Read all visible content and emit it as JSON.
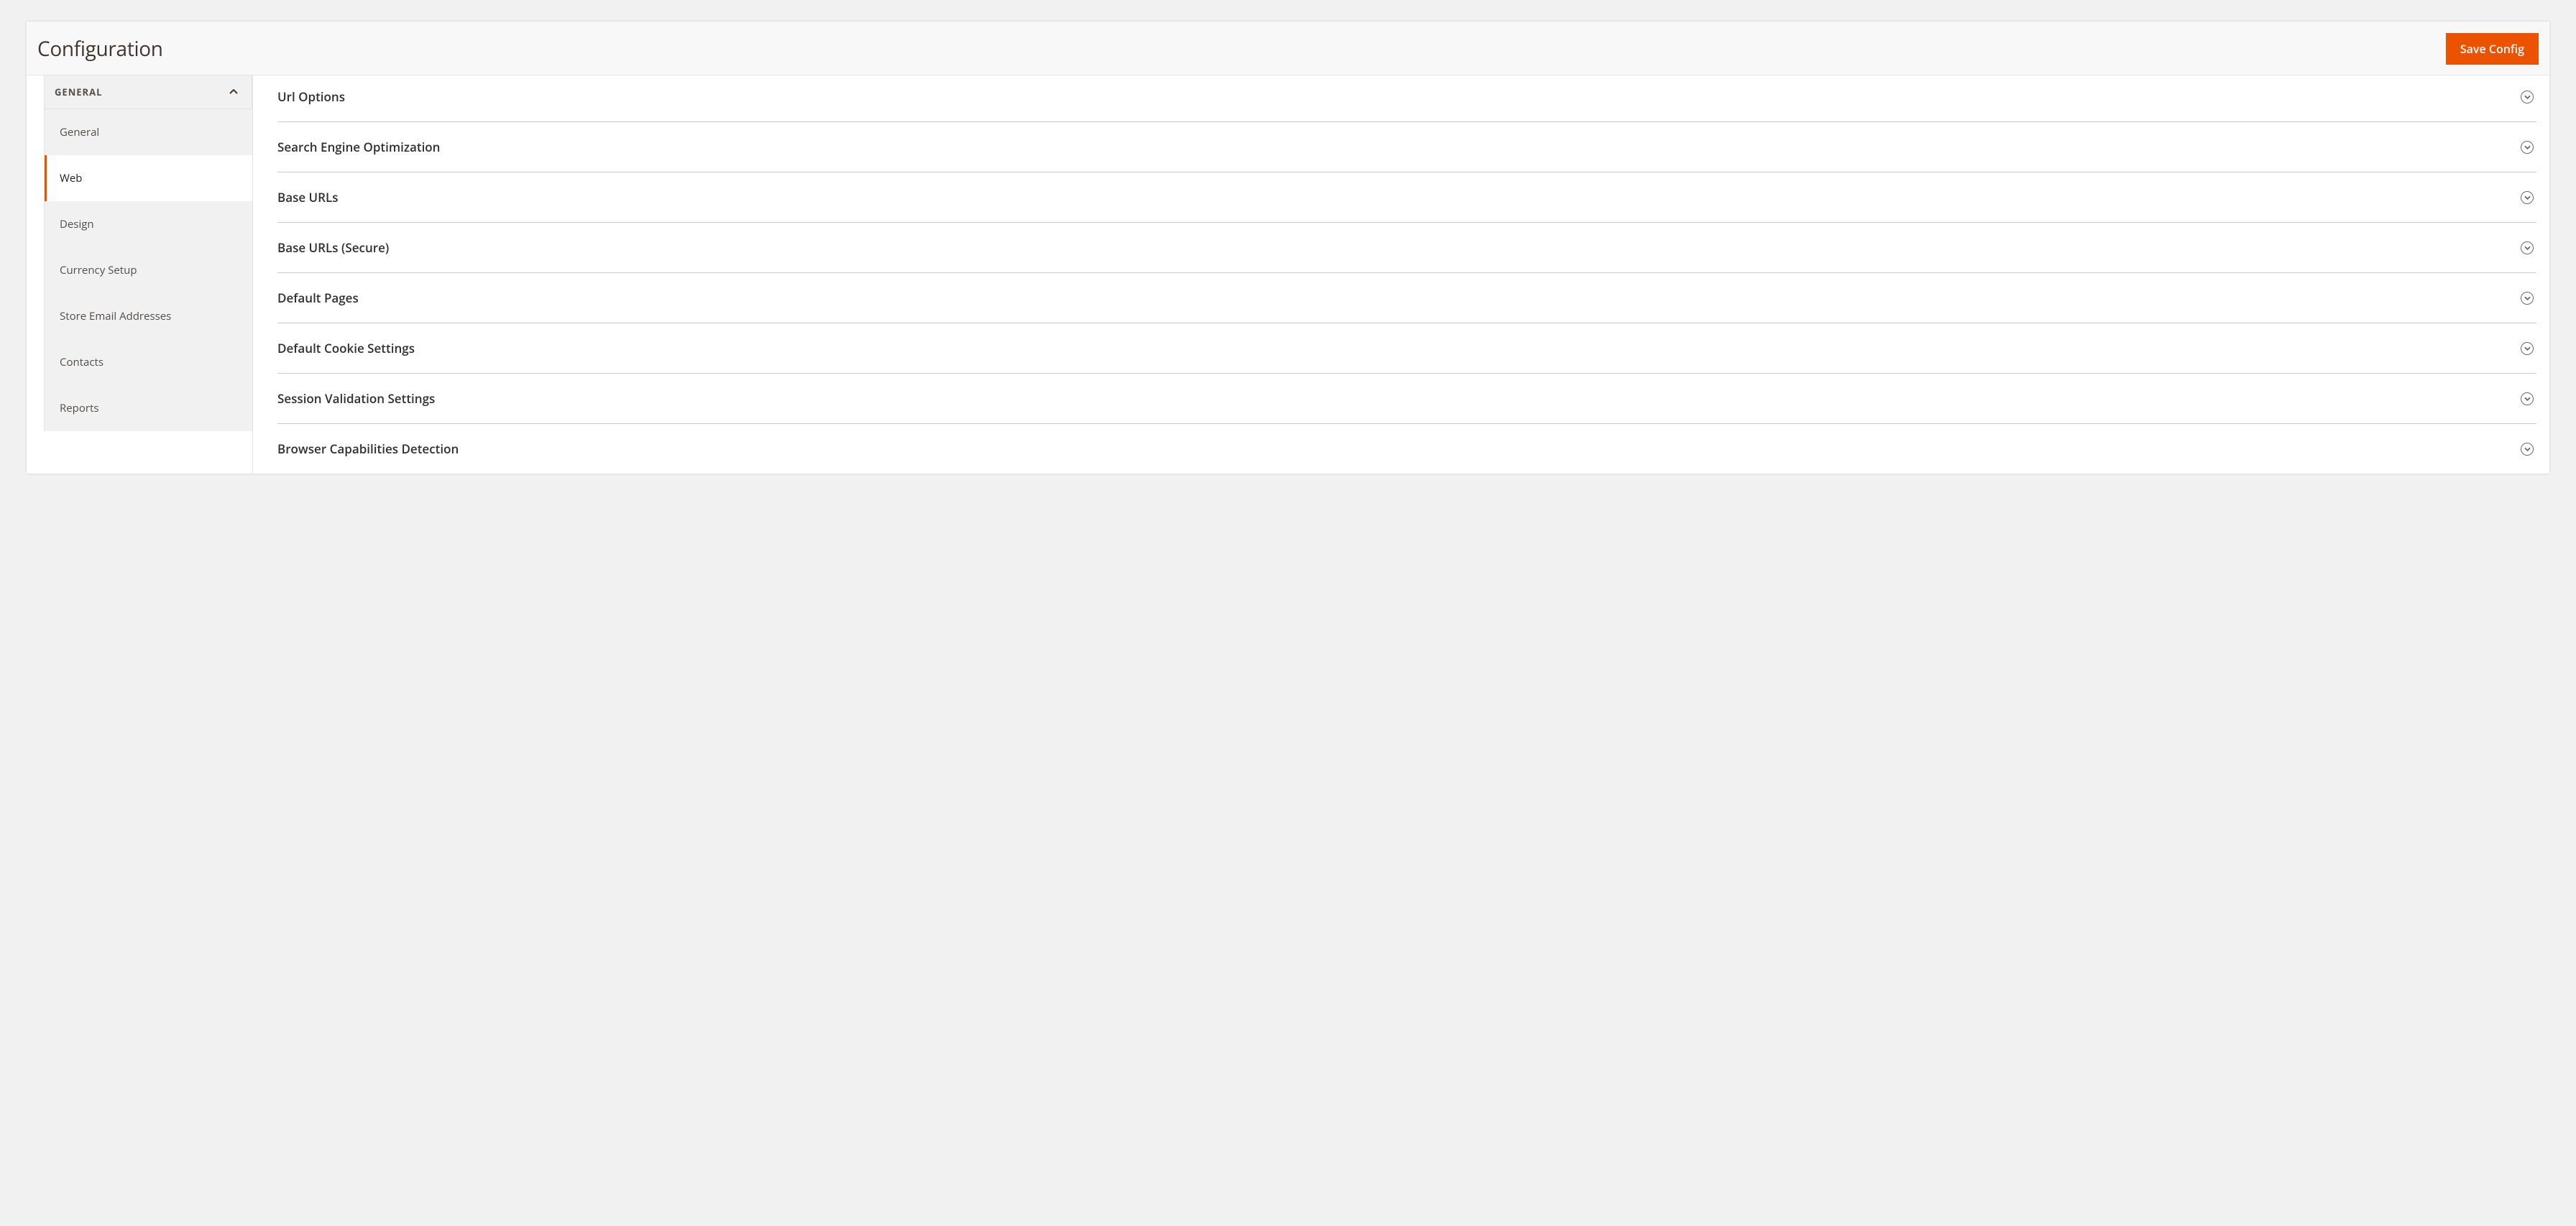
{
  "header": {
    "title": "Configuration",
    "save_label": "Save Config"
  },
  "sidebar": {
    "group_label": "GENERAL",
    "items": [
      {
        "label": "General",
        "active": false
      },
      {
        "label": "Web",
        "active": true
      },
      {
        "label": "Design",
        "active": false
      },
      {
        "label": "Currency Setup",
        "active": false
      },
      {
        "label": "Store Email Addresses",
        "active": false
      },
      {
        "label": "Contacts",
        "active": false
      },
      {
        "label": "Reports",
        "active": false
      }
    ]
  },
  "sections": [
    {
      "label": "Url Options"
    },
    {
      "label": "Search Engine Optimization"
    },
    {
      "label": "Base URLs"
    },
    {
      "label": "Base URLs (Secure)"
    },
    {
      "label": "Default Pages"
    },
    {
      "label": "Default Cookie Settings"
    },
    {
      "label": "Session Validation Settings"
    },
    {
      "label": "Browser Capabilities Detection"
    }
  ]
}
